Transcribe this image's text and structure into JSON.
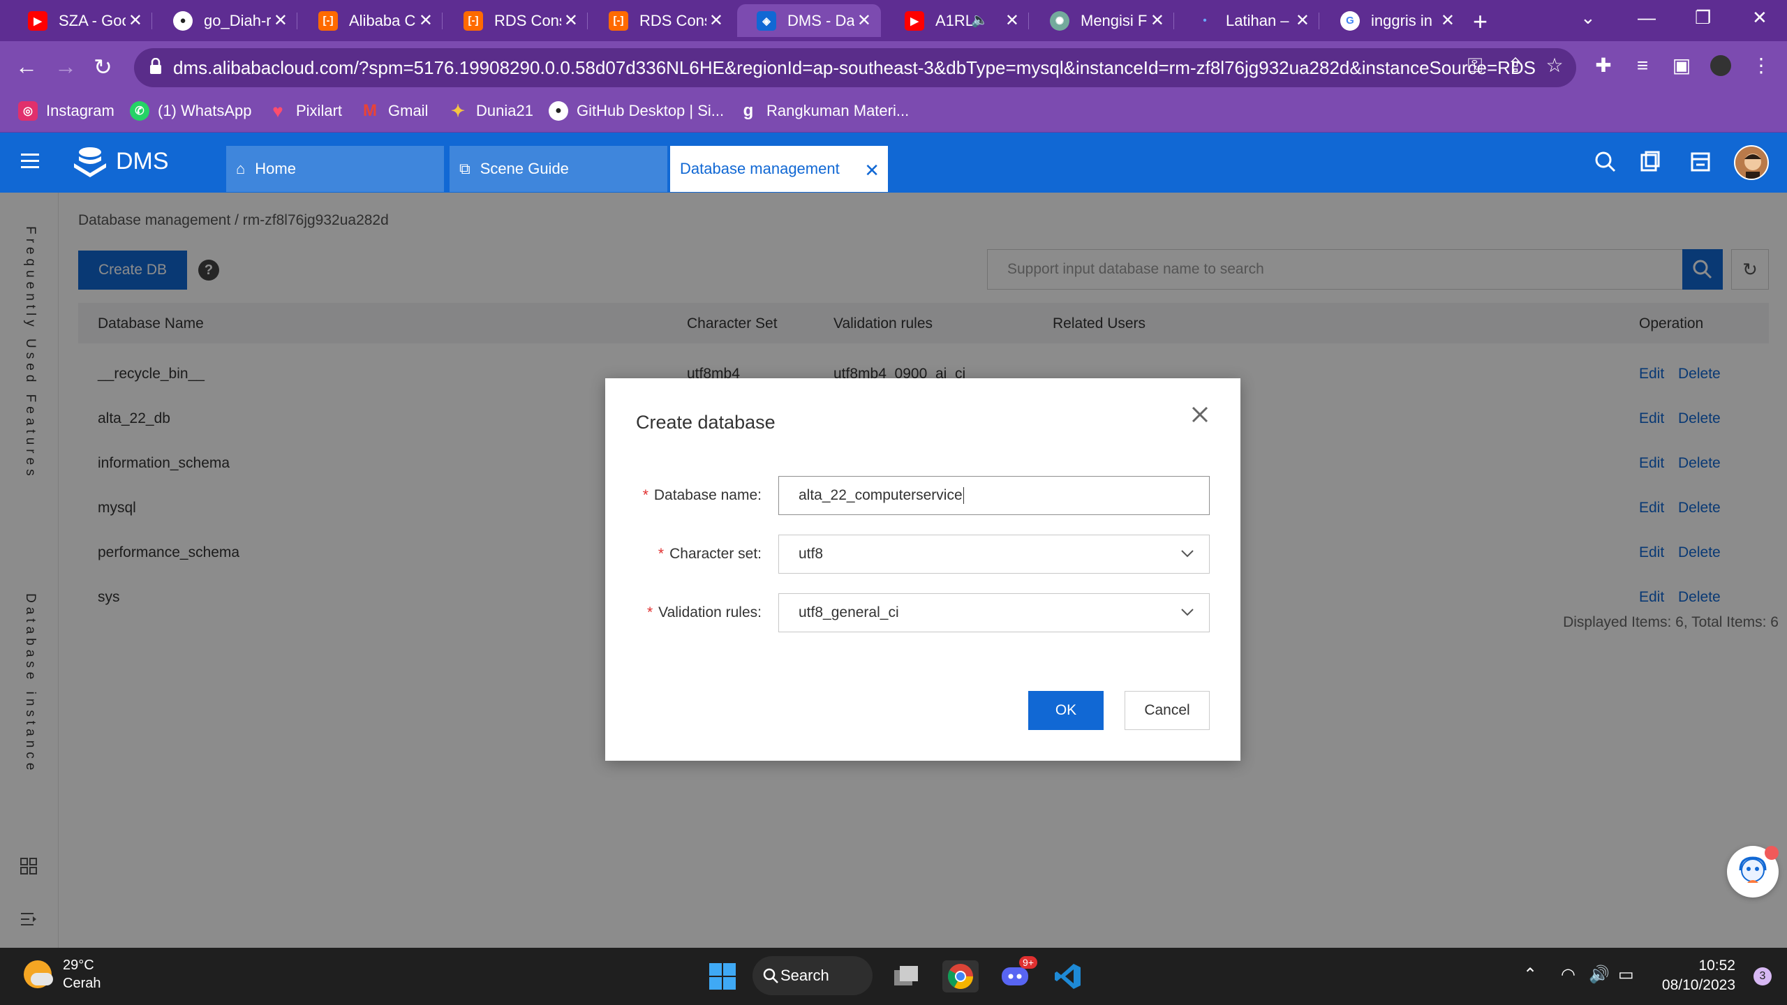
{
  "browser": {
    "tabs": [
      {
        "label": "SZA - Goo",
        "icon": "youtube-icon",
        "color": "#ff0000"
      },
      {
        "label": "go_Diah-r",
        "icon": "github-icon",
        "color": "#ffffff"
      },
      {
        "label": "Alibaba C",
        "icon": "alibaba-icon",
        "color": "#ff6a00"
      },
      {
        "label": "RDS Cons",
        "icon": "alibaba-icon",
        "color": "#ff6a00"
      },
      {
        "label": "RDS Cons",
        "icon": "alibaba-icon",
        "color": "#ff6a00"
      },
      {
        "label": "DMS - Da",
        "icon": "dms-icon",
        "color": "#1168d4"
      },
      {
        "label": "A1RL",
        "icon": "youtube-icon",
        "color": "#ff0000"
      },
      {
        "label": "Mengisi F",
        "icon": "chatgpt-icon",
        "color": "#74aa9c"
      },
      {
        "label": "Latihan –",
        "icon": "latihan-icon",
        "color": "#6aa9ff"
      },
      {
        "label": "inggris in",
        "icon": "google-icon",
        "color": "#ffffff"
      }
    ],
    "active_tab_index": 5,
    "url": "dms.alibabacloud.com/?spm=5176.19908290.0.0.58d07d336NL6HE&regionId=ap-southeast-3&dbType=mysql&instanceId=rm-zf8l76jg932ua282d&instanceSource=RDS",
    "bookmarks": [
      {
        "label": "Instagram",
        "icon": "instagram-icon"
      },
      {
        "label": "(1) WhatsApp",
        "icon": "whatsapp-icon"
      },
      {
        "label": "Pixilart",
        "icon": "heart-icon"
      },
      {
        "label": "Gmail",
        "icon": "gmail-icon"
      },
      {
        "label": "Dunia21",
        "icon": "dunia21-icon"
      },
      {
        "label": "GitHub Desktop | Si...",
        "icon": "github-icon"
      },
      {
        "label": "Rangkuman Materi...",
        "icon": "g-icon"
      }
    ]
  },
  "dms": {
    "logo_text": "DMS",
    "app_tabs": [
      {
        "label": "Home",
        "icon": "home-icon"
      },
      {
        "label": "Scene Guide",
        "icon": "scene-guide-icon"
      },
      {
        "label": "Database management",
        "icon": "close-icon"
      }
    ],
    "left_rail": {
      "frequently_used": "Frequently Used Features",
      "database_instance": "Database instance"
    },
    "breadcrumb": "Database management / rm-zf8l76jg932ua282d",
    "create_db_label": "Create DB",
    "search_placeholder": "Support input database name to search",
    "table": {
      "headers": [
        "Database Name",
        "Character Set",
        "Validation rules",
        "Related Users",
        "Operation"
      ],
      "rows": [
        {
          "name": "__recycle_bin__",
          "charset": "utf8mb4",
          "rules": "utf8mb4_0900_ai_ci"
        },
        {
          "name": "alta_22_db",
          "charset": "",
          "rules": ""
        },
        {
          "name": "information_schema",
          "charset": "",
          "rules": ""
        },
        {
          "name": "mysql",
          "charset": "",
          "rules": ""
        },
        {
          "name": "performance_schema",
          "charset": "",
          "rules": ""
        },
        {
          "name": "sys",
          "charset": "",
          "rules": ""
        }
      ],
      "edit_label": "Edit",
      "delete_label": "Delete"
    },
    "pagination": "Displayed Items: 6, Total Items: 6"
  },
  "modal": {
    "title": "Create database",
    "fields": {
      "db_name_label": "Database name:",
      "db_name_value": "alta_22_computerservice",
      "charset_label": "Character set:",
      "charset_value": "utf8",
      "rules_label": "Validation rules:",
      "rules_value": "utf8_general_ci"
    },
    "ok_label": "OK",
    "cancel_label": "Cancel"
  },
  "taskbar": {
    "temperature": "29°C",
    "weather": "Cerah",
    "search_label": "Search",
    "discord_badge": "9+",
    "time": "10:52",
    "date": "08/10/2023",
    "notification_count": "3"
  },
  "colors": {
    "browser_frame": "#5e2d92",
    "dms_blue": "#1168d4",
    "required": "#e03030"
  }
}
